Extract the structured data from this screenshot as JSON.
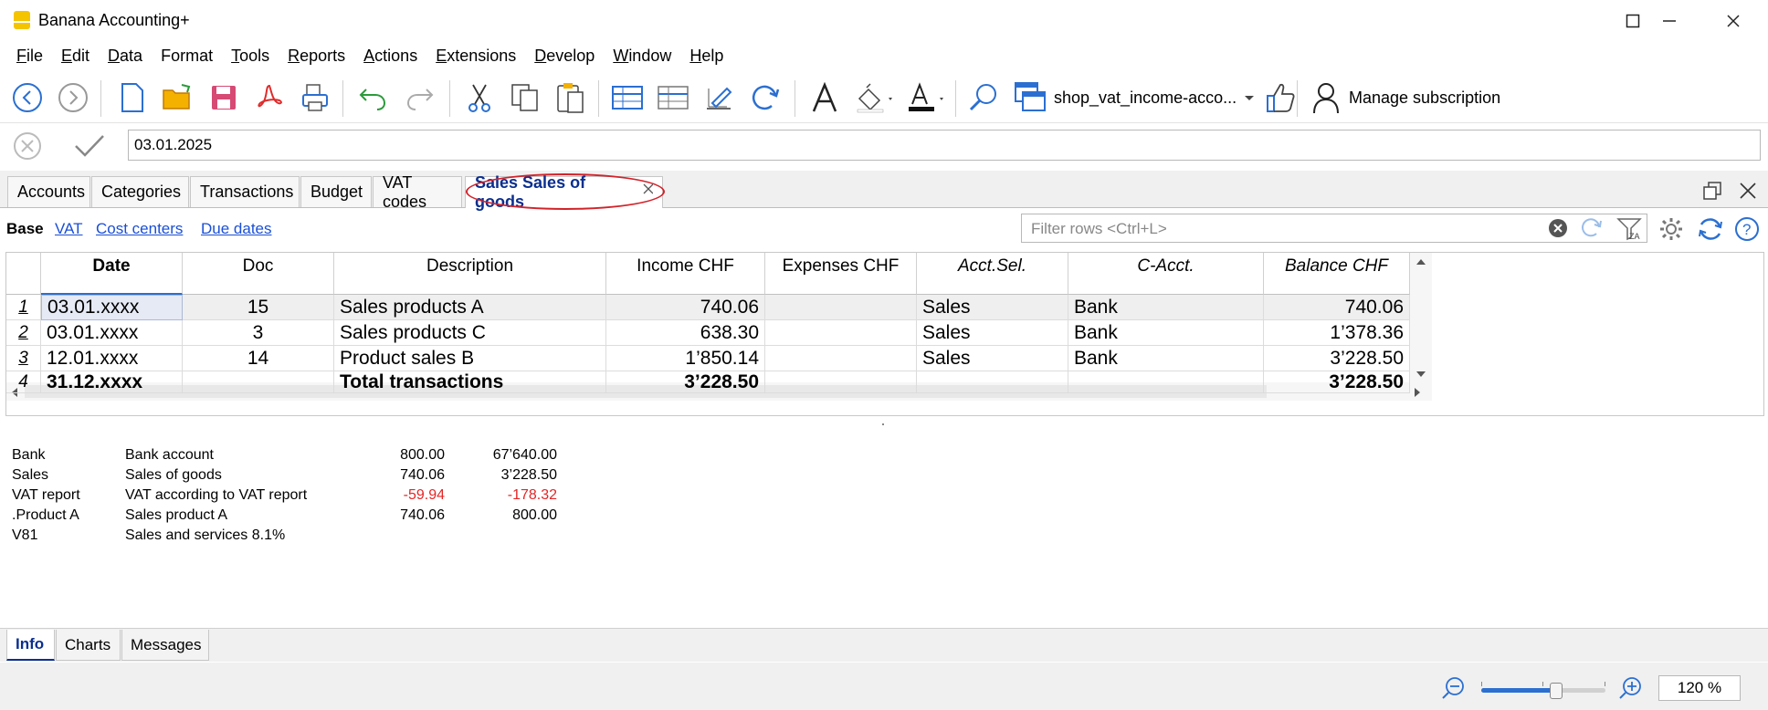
{
  "window": {
    "title": "Banana Accounting+"
  },
  "menu": [
    {
      "label": "File",
      "key": "F",
      "rest": "ile"
    },
    {
      "label": "Edit",
      "key": "E",
      "rest": "dit"
    },
    {
      "label": "Data",
      "key": "D",
      "rest": "ata"
    },
    {
      "label": "Format",
      "key": "F",
      "rest": "ormat"
    },
    {
      "label": "Tools",
      "key": "T",
      "rest": "ools"
    },
    {
      "label": "Reports",
      "key": "R",
      "rest": "eports"
    },
    {
      "label": "Actions",
      "key": "A",
      "rest": "ctions"
    },
    {
      "label": "Extensions",
      "key": "E",
      "rest": "xtensions"
    },
    {
      "label": "Develop",
      "key": "D",
      "rest": "evelop"
    },
    {
      "label": "Window",
      "key": "W",
      "rest": "indow"
    },
    {
      "label": "Help",
      "key": "H",
      "rest": "elp"
    }
  ],
  "toolbar": {
    "file_name": "shop_vat_income-acco...",
    "manage_subscription": "Manage subscription",
    "icons": [
      "back-icon",
      "forward-icon",
      "new-file-icon",
      "open-folder-icon",
      "save-icon",
      "pdf-icon",
      "print-icon",
      "undo-icon",
      "redo-icon",
      "cut-icon",
      "copy-icon",
      "paste-icon",
      "insert-rows-icon",
      "add-rows-icon",
      "edit-icon",
      "recalculate-icon",
      "font-icon",
      "fill-color-icon",
      "text-color-icon",
      "search-icon"
    ]
  },
  "edit_line": {
    "value": "03.01.2025"
  },
  "tabs": [
    "Accounts",
    "Categories",
    "Transactions",
    "Budget",
    "VAT codes",
    "Sales Sales of goods"
  ],
  "views": {
    "base": "Base",
    "links": [
      "VAT",
      "Cost centers",
      "Due dates"
    ]
  },
  "filter": {
    "placeholder": "Filter rows <Ctrl+L>"
  },
  "table": {
    "headers": [
      "Date",
      "Doc",
      "Description",
      "Income CHF",
      "Expenses CHF",
      "Acct.Sel.",
      "C-Acct.",
      "Balance CHF"
    ],
    "rows": [
      {
        "n": "1",
        "date": "03.01.xxxx",
        "doc": "15",
        "desc": "Sales products A",
        "income": "740.06",
        "expenses": "",
        "acctsel": "Sales",
        "cacct": "Bank",
        "balance": "740.06"
      },
      {
        "n": "2",
        "date": "03.01.xxxx",
        "doc": "3",
        "desc": "Sales products C",
        "income": "638.30",
        "expenses": "",
        "acctsel": "Sales",
        "cacct": "Bank",
        "balance": "1’378.36"
      },
      {
        "n": "3",
        "date": "12.01.xxxx",
        "doc": "14",
        "desc": "Product sales B",
        "income": "1’850.14",
        "expenses": "",
        "acctsel": "Sales",
        "cacct": "Bank",
        "balance": "3’228.50"
      },
      {
        "n": "4",
        "date": "31.12.xxxx",
        "doc": "",
        "desc": "Total transactions",
        "income": "3’228.50",
        "expenses": "",
        "acctsel": "",
        "cacct": "",
        "balance": "3’228.50"
      }
    ]
  },
  "info": [
    {
      "code": "Bank",
      "desc": "Bank account",
      "v1": "800.00",
      "v2": "67’640.00"
    },
    {
      "code": "Sales",
      "desc": "Sales of goods",
      "v1": "740.06",
      "v2": "3’228.50"
    },
    {
      "code": "VAT report",
      "desc": "VAT according to VAT report",
      "v1": "-59.94",
      "v2": "-178.32"
    },
    {
      "code": ".Product A",
      "desc": "Sales product A",
      "v1": "740.06",
      "v2": "800.00"
    },
    {
      "code": "V81",
      "desc": "Sales and services 8.1%",
      "v1": "",
      "v2": ""
    }
  ],
  "bottom_tabs": [
    "Info",
    "Charts",
    "Messages"
  ],
  "zoom": {
    "value": "120 %",
    "level": 0.6
  },
  "colors": {
    "active_tab": "#0b2f8f",
    "highlight_circle": "#d2232a",
    "negative": "#e32626",
    "link": "#1a4fd6"
  }
}
